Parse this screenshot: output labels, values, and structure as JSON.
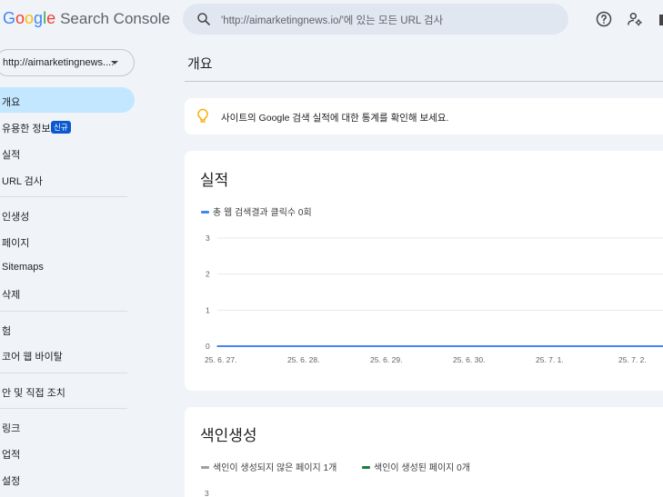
{
  "app": {
    "logo_letters": [
      "G",
      "o",
      "o",
      "g",
      "l",
      "e"
    ],
    "product": "Search Console"
  },
  "search": {
    "placeholder": "'http://aimarketingnews.io/'에 있는 모든 URL 검사"
  },
  "header_icons": [
    "help-icon",
    "user-settings-icon"
  ],
  "sidebar": {
    "property": "http://aimarketingnews....",
    "items": [
      {
        "label": "개요",
        "active": true
      },
      {
        "label": "유용한 정보",
        "badge": "신규"
      },
      {
        "label": "실적"
      },
      {
        "label": "URL 검사"
      },
      {
        "label": "인생성"
      },
      {
        "label": "페이지"
      },
      {
        "label": "Sitemaps"
      },
      {
        "label": "삭제"
      },
      {
        "label": "험"
      },
      {
        "label": "코어 웹 바이탈"
      },
      {
        "label": "안 및 직접 조치"
      },
      {
        "label": "링크"
      },
      {
        "label": "업적"
      },
      {
        "label": "설정"
      }
    ]
  },
  "main": {
    "title": "개요",
    "tip": {
      "text": "사이트의 Google 검색 실적에 대한 통계를 확인해 보세요."
    },
    "performance": {
      "title": "실적",
      "legend": "총 웹 검색결과 클릭수 0회"
    },
    "indexing": {
      "title": "색인생성",
      "legend": [
        {
          "label": "색인이 생성되지 않은 페이지 1개",
          "color": "#9aa0a6"
        },
        {
          "label": "색인이 생성된 페이지 0개",
          "color": "#188038"
        }
      ],
      "first_tick": "3"
    }
  },
  "colors": {
    "accent": "#4285f4",
    "active_bg": "#c2e7ff",
    "badge": "#0b57d0"
  },
  "chart_data": {
    "type": "line",
    "title": "실적",
    "series": [
      {
        "name": "총 웹 검색결과 클릭수 0회",
        "color": "#4285f4",
        "values": [
          0,
          0,
          0,
          0,
          0,
          0,
          0
        ]
      }
    ],
    "categories": [
      "25. 6. 27.",
      "25. 6. 28.",
      "25. 6. 29.",
      "25. 6. 30.",
      "25. 7. 1.",
      "25. 7. 2.",
      ""
    ],
    "tick_labels": [
      "25. 6. 27.",
      "25. 6. 28.",
      "25. 6. 29.",
      "25. 6. 30.",
      "25. 7. 1.",
      "25. 7. 2."
    ],
    "y_ticks": [
      "0",
      "1",
      "2",
      "3"
    ],
    "ylim": [
      0,
      3
    ],
    "grid": true
  }
}
